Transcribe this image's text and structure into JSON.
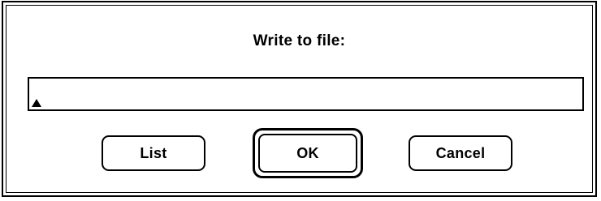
{
  "dialog": {
    "title": "Write to file:",
    "input": {
      "value": "",
      "caret_icon": "caret-icon"
    },
    "buttons": {
      "list": "List",
      "ok": "OK",
      "cancel": "Cancel"
    }
  }
}
